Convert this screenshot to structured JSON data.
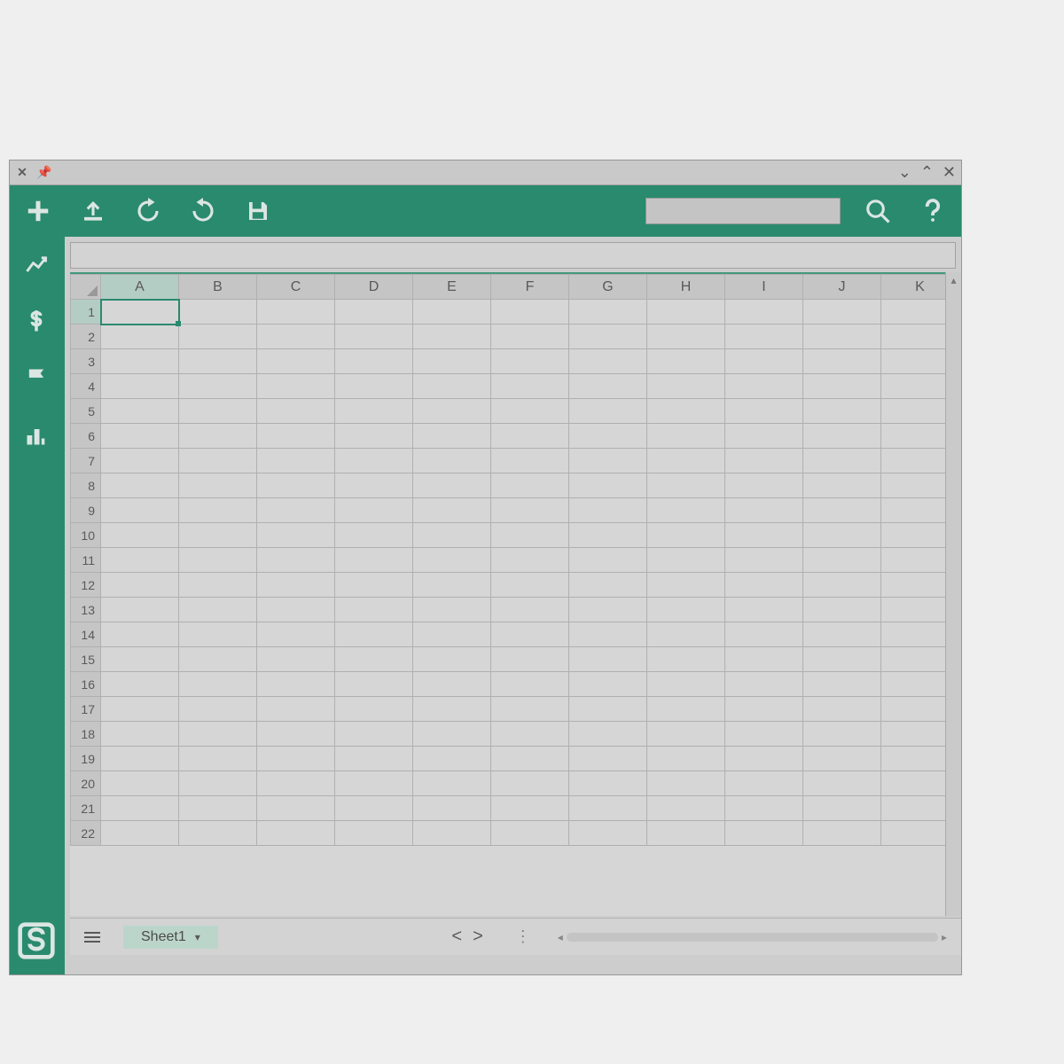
{
  "colors": {
    "accent": "#1f8d6d"
  },
  "columns": [
    "A",
    "B",
    "C",
    "D",
    "E",
    "F",
    "G",
    "H",
    "I",
    "J",
    "K"
  ],
  "rows": [
    1,
    2,
    3,
    4,
    5,
    6,
    7,
    8,
    9,
    10,
    11,
    12,
    13,
    14,
    15,
    16,
    17,
    18,
    19,
    20,
    21,
    22
  ],
  "selected_cell": {
    "col": "A",
    "row": 1
  },
  "sheet_tab": {
    "name": "Sheet1"
  },
  "search": {
    "value": ""
  },
  "toolbar_icons": [
    "new",
    "upload",
    "undo",
    "redo",
    "save",
    "search",
    "help"
  ],
  "sidebar_icons": [
    "chart",
    "currency",
    "flag",
    "bar-chart",
    "app-logo"
  ]
}
